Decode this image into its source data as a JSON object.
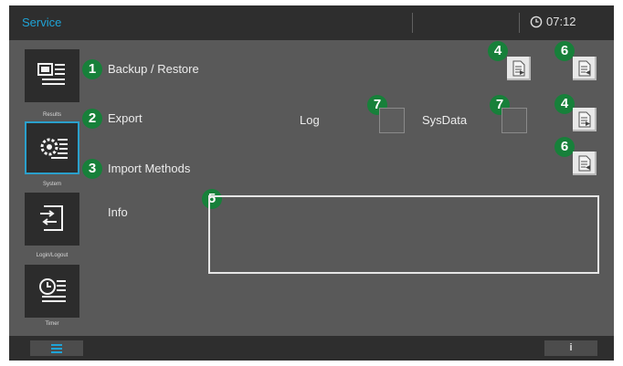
{
  "header": {
    "title": "Service",
    "time": "07:12"
  },
  "sidebar": {
    "items": [
      {
        "label": "Results",
        "icon": "results-icon"
      },
      {
        "label": "System",
        "icon": "system-icon"
      },
      {
        "label": "Login/Logout",
        "icon": "login-logout-icon"
      },
      {
        "label": "Timer",
        "icon": "timer-icon"
      }
    ]
  },
  "main": {
    "backup_restore_label": "Backup / Restore",
    "export_label": "Export",
    "log_label": "Log",
    "sysdata_label": "SysData",
    "import_methods_label": "Import Methods",
    "info_label": "Info"
  },
  "callouts": [
    "1",
    "2",
    "3",
    "4",
    "4",
    "5",
    "6",
    "6",
    "7",
    "7"
  ],
  "footer": {
    "info_label": "i"
  },
  "colors": {
    "accent": "#1fa3d6",
    "callout_green": "#17803a",
    "panel": "#595959",
    "bar": "#2e2e2e"
  }
}
